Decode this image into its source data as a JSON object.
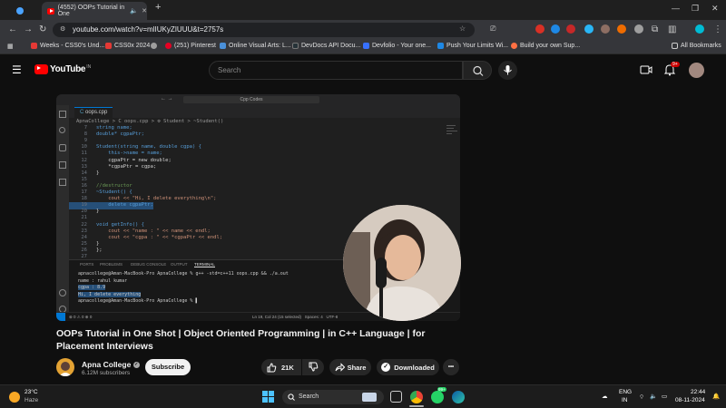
{
  "browser": {
    "tabs": [
      {
        "label": ""
      },
      {
        "label": "(4552) OOPs Tutorial in One"
      }
    ],
    "new_tab": "+",
    "url": "youtube.com/watch?v=mlIUKyZIUUU&t=2757s",
    "win_minimize": "—",
    "win_maximize": "❐",
    "win_close": "✕",
    "bookmarks": [
      {
        "label": "Weeks - CSS0's Und...",
        "color": "#e53935"
      },
      {
        "label": "CSS0x 2024",
        "color": "#e53935"
      },
      {
        "label": "",
        "color": "#9e9e9e"
      },
      {
        "label": "(251) Pinterest",
        "color": "#e60023"
      },
      {
        "label": "Online Visual Arts: L...",
        "color": "#4a90d9"
      },
      {
        "label": "DevDocs API Docu...",
        "color": "#263238"
      },
      {
        "label": "Devfolio - Your one...",
        "color": "#3770ff"
      },
      {
        "label": "Push Your Limits Wi...",
        "color": "#1e88e5"
      },
      {
        "label": "Build your own Sup...",
        "color": "#ff7043"
      }
    ],
    "all_bookmarks": "All Bookmarks"
  },
  "youtube": {
    "logo_text": "YouTube",
    "region": "IN",
    "search_placeholder": "Search",
    "notification_count": "9+"
  },
  "video_frame": {
    "command_center": "Cpp Codes",
    "file_tab": "oops.cpp",
    "breadcrumb": "ApnaCollege > C oops.cpp > ⚙ Student > ~Student()",
    "code": [
      {
        "n": "7",
        "text": "string name;"
      },
      {
        "n": "8",
        "text": "double* cgpaPtr;"
      },
      {
        "n": "9",
        "text": ""
      },
      {
        "n": "10",
        "text": "Student(string name, double cgpa) {"
      },
      {
        "n": "11",
        "text": "    this->name = name;"
      },
      {
        "n": "12",
        "text": "    cgpaPtr = new double;"
      },
      {
        "n": "13",
        "text": "    *cgpaPtr = cgpa;"
      },
      {
        "n": "14",
        "text": "}"
      },
      {
        "n": "15",
        "text": ""
      },
      {
        "n": "16",
        "text": "//destructor"
      },
      {
        "n": "17",
        "text": "~Student() {"
      },
      {
        "n": "18",
        "text": "    cout << \"Hi, I delete everything\\n\";"
      },
      {
        "n": "19",
        "text": "    delete cgpaPtr;"
      },
      {
        "n": "20",
        "text": "}"
      },
      {
        "n": "21",
        "text": ""
      },
      {
        "n": "22",
        "text": "void getInfo() {"
      },
      {
        "n": "23",
        "text": "    cout << \"name : \" << name << endl;"
      },
      {
        "n": "24",
        "text": "    cout << \"cgpa : \" << *cgpaPtr << endl;"
      },
      {
        "n": "25",
        "text": "}"
      },
      {
        "n": "26",
        "text": "};"
      },
      {
        "n": "27",
        "text": ""
      }
    ],
    "terminal_tabs": [
      "PORTS",
      "PROBLEMS",
      "DEBUG CONSOLE",
      "OUTPUT",
      "TERMINAL"
    ],
    "terminal_shell": "zsh - Apna",
    "terminal_lines": [
      "apnacollege@Aman-MacBook-Pro ApnaCollege % g++ -std=c++11 oops.cpp && ./a.out",
      "name : rahul kumar",
      "cgpa : 8.9",
      "Hi, I delete everything",
      "apnacollege@Aman-MacBook-Pro ApnaCollege % ▌"
    ],
    "status_left": "⊗ 0 ⚠ 0   ⊕ 0",
    "status_right": "Ln 19, Col 24 (15 selected)   Spaces: 4   UTF-8"
  },
  "video": {
    "title": "OOPs Tutorial in One Shot | Object Oriented Programming | in C++ Language | for Placement Interviews",
    "channel": "Apna College",
    "subscribers": "6.12M subscribers",
    "subscribe_label": "Subscribe",
    "likes": "21K",
    "share_label": "Share",
    "downloaded_label": "Downloaded",
    "more_label": "•••"
  },
  "taskbar": {
    "weather_temp": "23°C",
    "weather_desc": "Haze",
    "search_placeholder": "Search",
    "badge": "99+",
    "lang_top": "ENG",
    "lang_bottom": "IN",
    "time": "22:44",
    "date": "08-11-2024"
  }
}
